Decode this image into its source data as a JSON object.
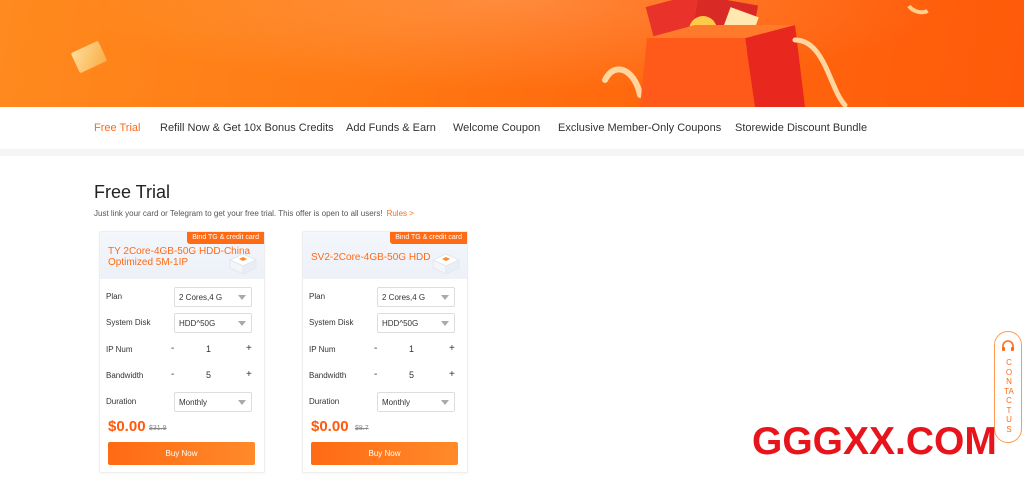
{
  "colors": {
    "accent": "#ff6a14",
    "banner": "#ff7a14",
    "watermark": "#e8141b"
  },
  "nav": {
    "items": [
      {
        "label": "Free Trial",
        "active": true
      },
      {
        "label": "Refill Now & Get 10x Bonus Credits",
        "active": false
      },
      {
        "label": "Add Funds & Earn",
        "active": false
      },
      {
        "label": "Welcome Coupon",
        "active": false
      },
      {
        "label": "Exclusive Member-Only Coupons",
        "active": false
      },
      {
        "label": "Storewide Discount Bundle",
        "active": false
      }
    ]
  },
  "section": {
    "title": "Free Trial",
    "subtitle": "Just link your card or Telegram to get your free trial. This offer is open to all users!",
    "rules_link": "Rules >"
  },
  "cards": [
    {
      "badge": "Bind TG & credit card",
      "title": "TY 2Core-4GB-50G HDD-China Optimized 5M-1IP",
      "plan_label": "Plan",
      "plan_value": "2 Cores,4 G",
      "disk_label": "System Disk",
      "disk_value": "HDD^50G",
      "ip_label": "IP Num",
      "ip_value": "1",
      "bw_label": "Bandwidth",
      "bw_value": "5",
      "duration_label": "Duration",
      "duration_value": "Monthly",
      "price": "$0.00",
      "old_price": "$31.9",
      "buy_label": "Buy Now",
      "minus": "-",
      "plus": "+"
    },
    {
      "badge": "Bind TG & credit card",
      "title": "SV2-2Core-4GB-50G HDD",
      "plan_label": "Plan",
      "plan_value": "2 Cores,4 G",
      "disk_label": "System Disk",
      "disk_value": "HDD^50G",
      "ip_label": "IP Num",
      "ip_value": "1",
      "bw_label": "Bandwidth",
      "bw_value": "5",
      "duration_label": "Duration",
      "duration_value": "Monthly",
      "price": "$0.00",
      "old_price": "$8.7",
      "buy_label": "Buy Now",
      "minus": "-",
      "plus": "+"
    }
  ],
  "contact": {
    "label": "CONTACTUS",
    "icon": "headset-icon"
  },
  "watermark": "GGGXX.COM"
}
